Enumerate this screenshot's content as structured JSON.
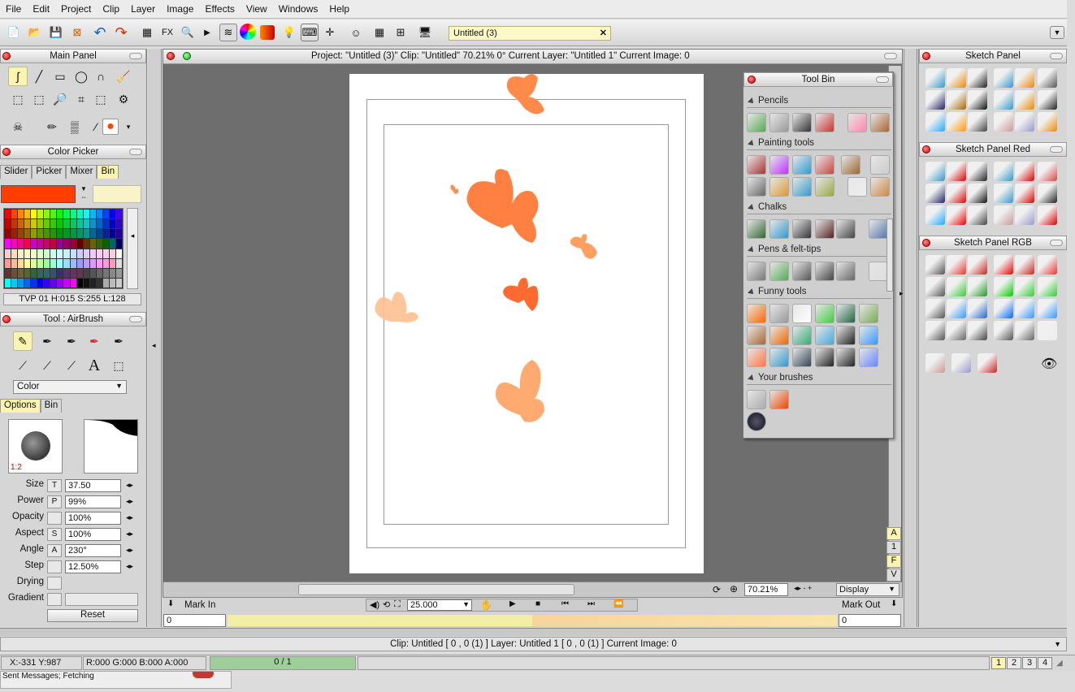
{
  "menu": [
    "File",
    "Edit",
    "Project",
    "Clip",
    "Layer",
    "Image",
    "Effects",
    "View",
    "Windows",
    "Help"
  ],
  "toolbar": {
    "fx_label": "FX",
    "doc_tab": "Untitled (3)",
    "close": "✕"
  },
  "main_panel": {
    "title": "Main Panel"
  },
  "color_picker": {
    "title": "Color Picker",
    "tabs": [
      "Slider",
      "Picker",
      "Mixer",
      "Bin"
    ],
    "current_color": "#ff3e00",
    "info": "TVP 01 H:015 S:255 L:128"
  },
  "tool_panel": {
    "title": "Tool : AirBrush",
    "mode": "Color",
    "tabs": [
      "Options",
      "Bin"
    ],
    "ratio": "1:2",
    "fields": [
      {
        "label": "Size",
        "btn": "T",
        "value": "37.50"
      },
      {
        "label": "Power",
        "btn": "P",
        "value": "99%"
      },
      {
        "label": "Opacity",
        "btn": "",
        "value": "100%"
      },
      {
        "label": "Aspect",
        "btn": "S",
        "value": "100%"
      },
      {
        "label": "Angle",
        "btn": "A",
        "value": "230°"
      },
      {
        "label": "Step",
        "btn": "",
        "value": "12.50%"
      }
    ],
    "drying": "Drying",
    "gradient": "Gradient",
    "reset": "Reset"
  },
  "main_window": {
    "title": "Project:  \"Untitled (3)\"  Clip: \"Untitled\"   70.21%   0°   Current Layer: \"Untitled 1\"  Current Image: 0",
    "zoom": "70.21%",
    "display": "Display",
    "side_letters": [
      "A",
      "1",
      "F",
      "V"
    ]
  },
  "timeline": {
    "mark_in": "Mark In",
    "mark_out": "Mark Out",
    "fps": "25.000",
    "in_value": "0",
    "out_value": "0"
  },
  "tool_bin": {
    "title": "Tool Bin",
    "sections": [
      "Pencils",
      "Painting tools",
      "Chalks",
      "Pens & felt-tips",
      "Funny tools",
      "Your brushes"
    ]
  },
  "sketch_panels": [
    "Sketch Panel",
    "Sketch Panel Red",
    "Sketch Panel RGB"
  ],
  "status": {
    "clip": "Clip: Untitled [ 0 , 0  (1) ]     Layer: Untitled 1 [ 0 , 0  (1) ]    Current Image: 0"
  },
  "bottom": {
    "coords": "X:-331  Y:987",
    "rgba": "R:000 G:000 B:000 A:000",
    "frame": "0 / 1",
    "pages": [
      "1",
      "2",
      "3",
      "4"
    ],
    "msg": "Sent Messages; Fetching"
  }
}
